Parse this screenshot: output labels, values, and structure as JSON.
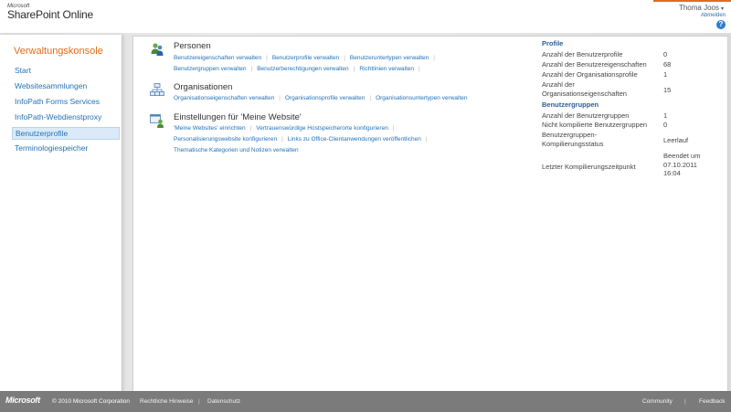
{
  "header": {
    "logo_small": "Microsoft",
    "logo_product": "SharePoint Online",
    "user_name": "Thoma Joos",
    "sign_out": "Abmelden",
    "help_glyph": "?"
  },
  "nav": {
    "title": "Verwaltungskonsole",
    "items": [
      {
        "label": "Start"
      },
      {
        "label": "Websitesammlungen"
      },
      {
        "label": "InfoPath Forms Services"
      },
      {
        "label": "InfoPath-Webdienstproxy"
      },
      {
        "label": "Benutzerprofile",
        "active": true
      },
      {
        "label": "Terminologiespeicher"
      }
    ]
  },
  "sections": {
    "personen": {
      "title": "Personen",
      "icon": "people-icon",
      "row1": [
        "Benutzereigenschaften verwalten",
        "Benutzerprofile verwalten",
        "Benutzeruntertypen verwalten"
      ],
      "row2": [
        "Benutzergruppen verwalten",
        "Benutzerberechtigungen verwalten",
        "Richtlinien verwalten"
      ]
    },
    "organisationen": {
      "title": "Organisationen",
      "icon": "org-chart-icon",
      "row1": [
        "Organisationseigenschaften verwalten",
        "Organisationsprofile verwalten",
        "Organisationsuntertypen verwalten"
      ]
    },
    "meinewebsite": {
      "title": "Einstellungen für 'Meine Website'",
      "icon": "my-site-icon",
      "row1": [
        "'Meine Websites' einrichten",
        "Vertrauenswürdige Hostspeicherorte konfigurieren"
      ],
      "row2": [
        "Personalisierungswebsite konfigurieren",
        "Links zu Office-Clientanwendungen veröffentlichen"
      ],
      "row3": [
        "Thematische Kategorien und Notizen verwalten"
      ]
    }
  },
  "stats": {
    "profile_heading": "Profile",
    "profile": [
      {
        "label": "Anzahl der Benutzerprofile",
        "value": "0"
      },
      {
        "label": "Anzahl der Benutzereigenschaften",
        "value": "68"
      },
      {
        "label": "Anzahl der Organisationsprofile",
        "value": "1"
      },
      {
        "label": "Anzahl der Organisationseigenschaften",
        "value": "15"
      }
    ],
    "groups_heading": "Benutzergruppen",
    "groups": [
      {
        "label": "Anzahl der Benutzergruppen",
        "value": "1"
      },
      {
        "label": "Nicht kompilierte Benutzergruppen",
        "value": "0"
      },
      {
        "label": "Benutzergruppen-Kompilierungsstatus",
        "value": "Leerlauf"
      },
      {
        "label": "Letzter Kompilierungszeitpunkt",
        "value": "Beendet um 07.10.2011 16:04"
      }
    ]
  },
  "footer": {
    "logo": "Microsoft",
    "copyright": "© 2010 Microsoft Corporation",
    "legal": "Rechtliche Hinweise",
    "privacy": "Datenschutz",
    "community": "Community",
    "feedback": "Feedback"
  },
  "colors": {
    "accent": "#e26c17",
    "link": "#2272b8",
    "footer": "#7b7b7b"
  }
}
